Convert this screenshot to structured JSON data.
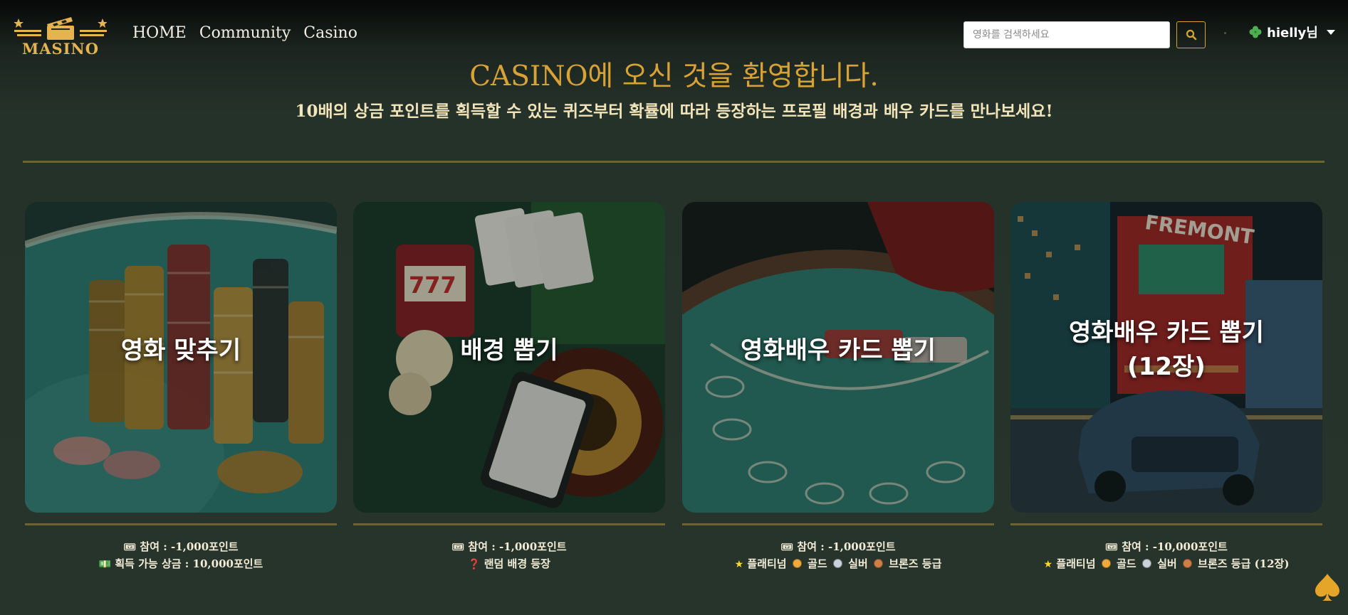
{
  "nav": {
    "logo_text": "MASINO",
    "links": [
      "HOME",
      "Community",
      "Casino"
    ],
    "search_placeholder": "영화를 검색하세요",
    "user_label": "hielly님",
    "user_icon": "clover-icon"
  },
  "hero": {
    "title": "CASINO에 오신 것을 환영합니다.",
    "subtitle": "10배의 상금 포인트를 획득할 수 있는 퀴즈부터 확률에 따라 등장하는 프로필 배경과 배우 카드를 만나보세요!"
  },
  "cards": [
    {
      "title": "영화 맞추기",
      "image": "casino-chips-stack",
      "line1": "참여 : -1,000포인트",
      "line2": "획득 가능 상금 : 10,000포인트",
      "line1_icon": "ticket-icon",
      "line2_icon": "money-icon"
    },
    {
      "title": "배경 뽑기",
      "image": "slot-cards-roulette",
      "line1": "참여 : -1,000포인트",
      "line2": "랜덤 배경 등장",
      "line1_icon": "ticket-icon",
      "line2_icon": "question-icon"
    },
    {
      "title": "영화배우 카드 뽑기",
      "image": "blackjack-table",
      "line1": "참여 : -1,000포인트",
      "line2_parts": [
        "플래티넘",
        "골드",
        "실버",
        "브론즈 등급"
      ],
      "line1_icon": "ticket-icon"
    },
    {
      "title": "영화배우 카드 뽑기\n(12장)",
      "image": "las-vegas-street",
      "line1": "참여 : -10,000포인트",
      "line2_parts": [
        "플래티넘",
        "골드",
        "실버",
        "브론즈 등급 (12장)"
      ],
      "line1_icon": "ticket-icon"
    }
  ],
  "colors": {
    "accent_gold": "#d9a235",
    "divider": "#6d6531",
    "background": "#26342c"
  },
  "floating_icon": "spade-icon"
}
